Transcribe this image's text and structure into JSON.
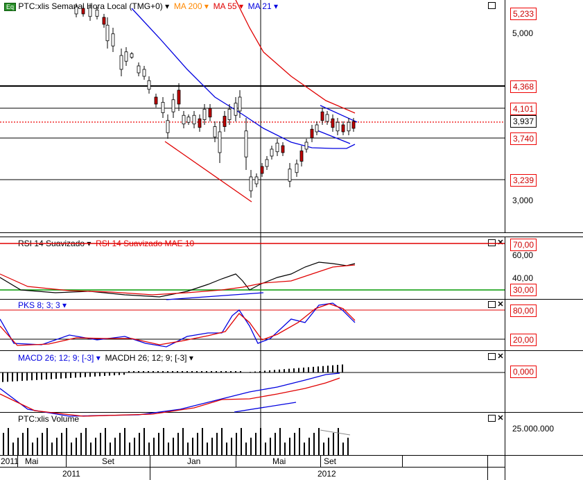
{
  "main": {
    "symbol_icon": "Eq",
    "title": "PTC:xlis Semanal Hora Local (TMG+0)",
    "ma200": "MA 200",
    "ma55": "MA 55",
    "ma21": "MA 21",
    "price_labels": [
      "5,233",
      "5,000",
      "4,368",
      "4,101",
      "3,937",
      "3,740",
      "3,239",
      "3,000"
    ],
    "colors": {
      "ma200": "#ff8800",
      "ma55": "#e00000",
      "ma21": "#0000e0"
    }
  },
  "rsi": {
    "title1": "RSI 14 Suavizado",
    "title2": "RSI 14 Suavizado MAE 10",
    "labels": [
      "70,00",
      "60,00",
      "40,00",
      "30,00"
    ]
  },
  "pks": {
    "title": "PKS 8; 3; 3",
    "labels": [
      "80,00",
      "20,00"
    ]
  },
  "macd": {
    "title1": "MACD 26; 12; 9; [-3]",
    "title2": "MACDH 26; 12; 9; [-3]",
    "labels": [
      "0,000"
    ]
  },
  "volume": {
    "title": "PTC:xlis Volume",
    "labels": [
      "25.000.000"
    ]
  },
  "dates": {
    "months": [
      "2011",
      "Mai",
      "Set",
      "Jan",
      "Mai",
      "Set"
    ],
    "years": [
      "2011",
      "2012"
    ]
  }
}
